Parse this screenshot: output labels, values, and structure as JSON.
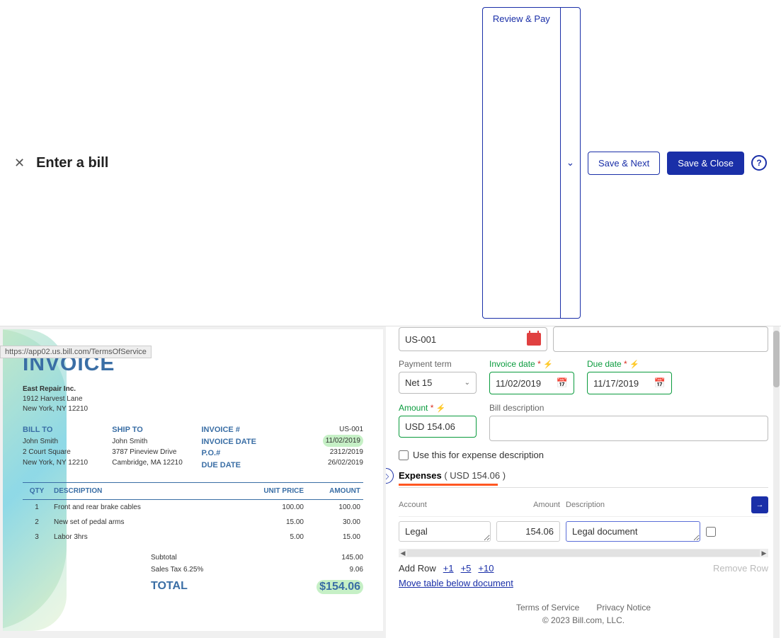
{
  "header": {
    "title": "Enter a bill",
    "review_pay": "Review & Pay",
    "save_next": "Save & Next",
    "save_close": "Save & Close"
  },
  "doc": {
    "title": "INVOICE",
    "company": {
      "name": "East Repair Inc.",
      "addr1": "1912 Harvest Lane",
      "addr2": "New York, NY 12210"
    },
    "bill_to_label": "BILL TO",
    "bill_to": {
      "name": "John Smith",
      "addr1": "2 Court Square",
      "addr2": "New York, NY 12210"
    },
    "ship_to_label": "SHIP TO",
    "ship_to": {
      "name": "John Smith",
      "addr1": "3787 Pineview Drive",
      "addr2": "Cambridge, MA 12210"
    },
    "meta_labels": {
      "inv": "INVOICE #",
      "date": "INVOICE DATE",
      "po": "P.O.#",
      "due": "DUE DATE"
    },
    "meta_vals": {
      "inv": "US-001",
      "date": "11/02/2019",
      "po": "2312/2019",
      "due": "26/02/2019"
    },
    "th": {
      "qty": "QTY",
      "desc": "DESCRIPTION",
      "unit": "UNIT PRICE",
      "amt": "AMOUNT"
    },
    "lines": [
      {
        "qty": "1",
        "desc": "Front and rear brake cables",
        "unit": "100.00",
        "amt": "100.00"
      },
      {
        "qty": "2",
        "desc": "New set of pedal arms",
        "unit": "15.00",
        "amt": "30.00"
      },
      {
        "qty": "3",
        "desc": "Labor 3hrs",
        "unit": "5.00",
        "amt": "15.00"
      }
    ],
    "subtotal_label": "Subtotal",
    "subtotal": "145.00",
    "tax_label": "Sales Tax 6.25%",
    "tax": "9.06",
    "total_label": "TOTAL",
    "total": "$154.06"
  },
  "form": {
    "top_input": "US-001",
    "payment_term_label": "Payment term",
    "payment_term": "Net 15",
    "invoice_date_label": "Invoice date",
    "invoice_date": "11/02/2019",
    "due_date_label": "Due date",
    "due_date": "11/17/2019",
    "amount_label": "Amount",
    "amount": "USD 154.06",
    "bill_desc_label": "Bill description",
    "use_expense_label": "Use this for expense description",
    "expenses_tab": "Expenses",
    "expenses_amount": "( USD 154.06 )",
    "grid": {
      "account": "Account",
      "amount": "Amount",
      "description": "Description"
    },
    "row": {
      "account": "Legal",
      "amount": "154.06",
      "description": "Legal document"
    },
    "add_row": "Add Row",
    "plus1": "+1",
    "plus5": "+5",
    "plus10": "+10",
    "remove_row": "Remove Row",
    "move_link": "Move table below document"
  },
  "footer": {
    "tos": "Terms of Service",
    "privacy": "Privacy Notice",
    "copyright": "© 2023 Bill.com, LLC."
  },
  "status_url": "https://app02.us.bill.com/TermsOfService"
}
